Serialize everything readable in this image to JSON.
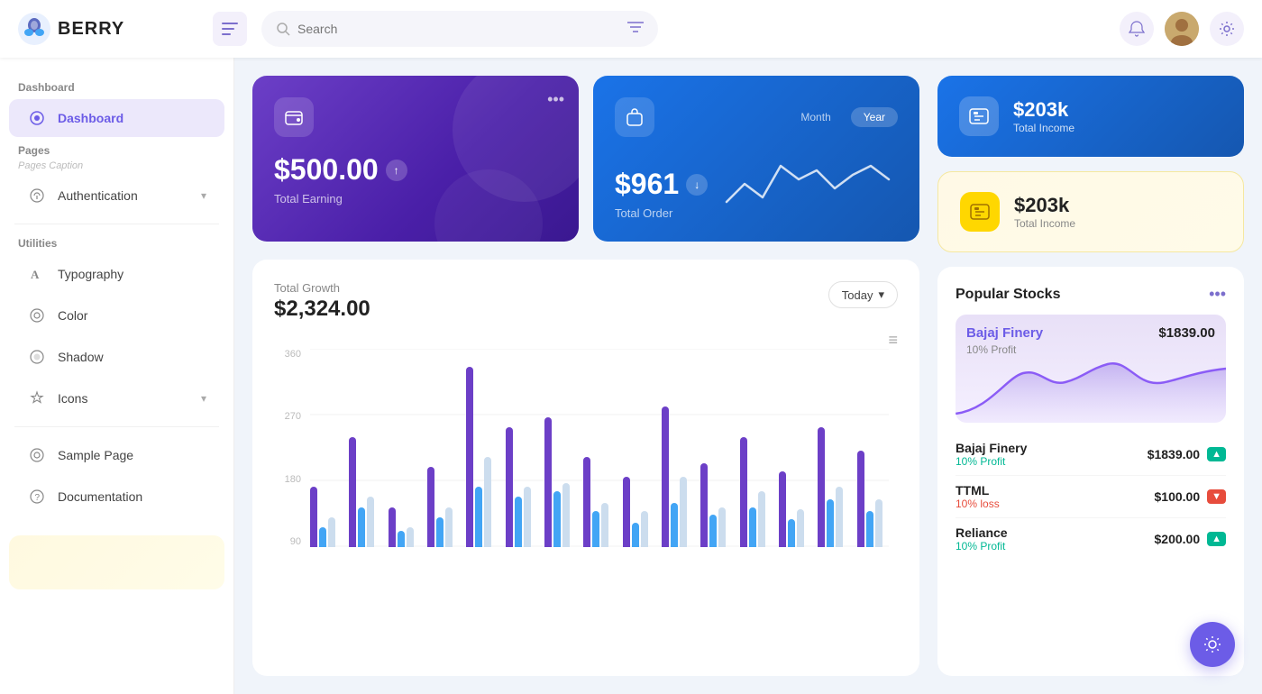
{
  "app": {
    "name": "BERRY"
  },
  "topnav": {
    "menu_label": "☰",
    "search_placeholder": "Search",
    "bell_icon": "🔔",
    "settings_icon": "⚙"
  },
  "sidebar": {
    "sections": [
      {
        "label": "Dashboard",
        "items": [
          {
            "id": "dashboard",
            "label": "Dashboard",
            "icon": "⊙",
            "active": true
          }
        ]
      },
      {
        "label": "Pages",
        "caption": "Pages Caption",
        "items": [
          {
            "id": "authentication",
            "label": "Authentication",
            "icon": "⟳",
            "hasChevron": true
          }
        ]
      },
      {
        "label": "Utilities",
        "items": [
          {
            "id": "typography",
            "label": "Typography",
            "icon": "A"
          },
          {
            "id": "color",
            "label": "Color",
            "icon": "◎"
          },
          {
            "id": "shadow",
            "label": "Shadow",
            "icon": "◉"
          },
          {
            "id": "icons",
            "label": "Icons",
            "icon": "✦",
            "hasChevron": true
          }
        ]
      },
      {
        "label": "",
        "items": [
          {
            "id": "sample-page",
            "label": "Sample Page",
            "icon": "◎"
          },
          {
            "id": "documentation",
            "label": "Documentation",
            "icon": "?"
          }
        ]
      }
    ]
  },
  "cards": {
    "earning": {
      "amount": "$500.00",
      "label": "Total Earning"
    },
    "order": {
      "amount": "$961",
      "label": "Total Order",
      "period_month": "Month",
      "period_year": "Year"
    }
  },
  "stats": [
    {
      "id": "total-income-blue",
      "amount": "$203k",
      "label": "Total Income",
      "style": "blue"
    },
    {
      "id": "total-income-yellow",
      "amount": "$203k",
      "label": "Total Income",
      "style": "yellow"
    }
  ],
  "growth": {
    "label": "Total Growth",
    "amount": "$2,324.00",
    "period": "Today",
    "y_labels": [
      "360",
      "270",
      "180",
      "90"
    ],
    "bars": [
      {
        "purple": 30,
        "blue": 10,
        "light": 15
      },
      {
        "purple": 55,
        "blue": 20,
        "light": 25
      },
      {
        "purple": 20,
        "blue": 8,
        "light": 10
      },
      {
        "purple": 40,
        "blue": 15,
        "light": 20
      },
      {
        "purple": 90,
        "blue": 30,
        "light": 45
      },
      {
        "purple": 60,
        "blue": 25,
        "light": 30
      },
      {
        "purple": 65,
        "blue": 28,
        "light": 32
      },
      {
        "purple": 45,
        "blue": 18,
        "light": 22
      },
      {
        "purple": 35,
        "blue": 12,
        "light": 18
      },
      {
        "purple": 70,
        "blue": 22,
        "light": 35
      },
      {
        "purple": 42,
        "blue": 16,
        "light": 20
      },
      {
        "purple": 55,
        "blue": 20,
        "light": 28
      },
      {
        "purple": 38,
        "blue": 14,
        "light": 19
      },
      {
        "purple": 60,
        "blue": 24,
        "light": 30
      },
      {
        "purple": 48,
        "blue": 18,
        "light": 24
      }
    ]
  },
  "stocks": {
    "title": "Popular Stocks",
    "featured": {
      "name": "Bajaj Finery",
      "price": "$1839.00",
      "profit_label": "10% Profit"
    },
    "list": [
      {
        "name": "Bajaj Finery",
        "price": "$1839.00",
        "change": "10% Profit",
        "trend": "up"
      },
      {
        "name": "TTML",
        "price": "$100.00",
        "change": "10% loss",
        "trend": "down"
      },
      {
        "name": "Reliance",
        "price": "$200.00",
        "change": "10% Profit",
        "trend": "up"
      }
    ]
  },
  "fab": {
    "icon": "⚙"
  }
}
